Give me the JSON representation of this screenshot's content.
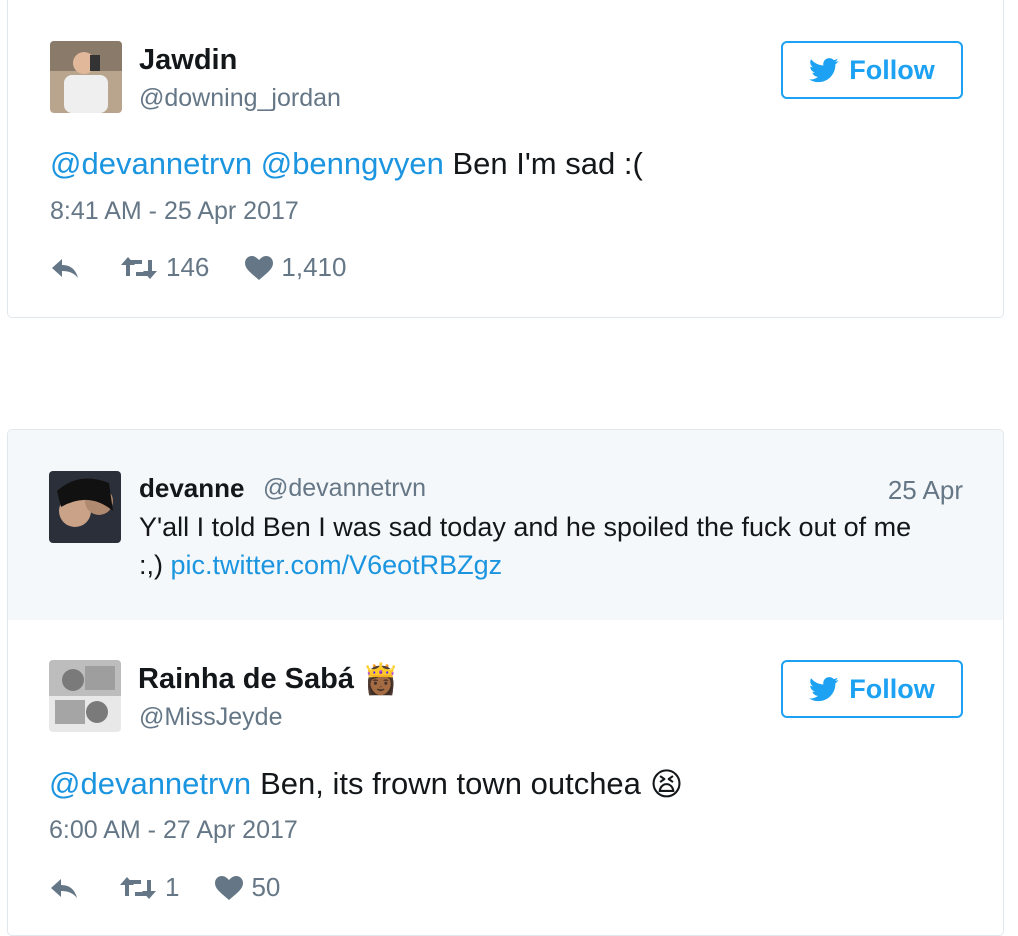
{
  "tweet1": {
    "name": "Jawdin",
    "handle": "@downing_jordan",
    "follow_label": "Follow",
    "mention1": "@devannetrvn",
    "mention2": "@benngvyen",
    "text": "Ben I'm sad :(",
    "timestamp": "8:41 AM - 25 Apr 2017",
    "retweets": "146",
    "likes": "1,410"
  },
  "quoted": {
    "name": "devanne",
    "handle": "@devannetrvn",
    "date": "25 Apr",
    "text_line1": "Y'all I told Ben I was sad today and he spoiled the fuck out of me",
    "text_line2_prefix": ":,)",
    "link": "pic.twitter.com/V6eotRBZgz"
  },
  "tweet2": {
    "name": "Rainha de Sabá",
    "name_emoji": "👸🏾",
    "handle": "@MissJeyde",
    "follow_label": "Follow",
    "mention": "@devannetrvn",
    "text": "Ben, its frown town outchea",
    "text_emoji": "😫",
    "timestamp": "6:00 AM - 27 Apr 2017",
    "retweets": "1",
    "likes": "50"
  },
  "colors": {
    "link_blue": "#1b95e0",
    "twitter_blue": "#1da1f2",
    "muted_gray": "#657786",
    "quote_bg": "#f5f8fa"
  }
}
